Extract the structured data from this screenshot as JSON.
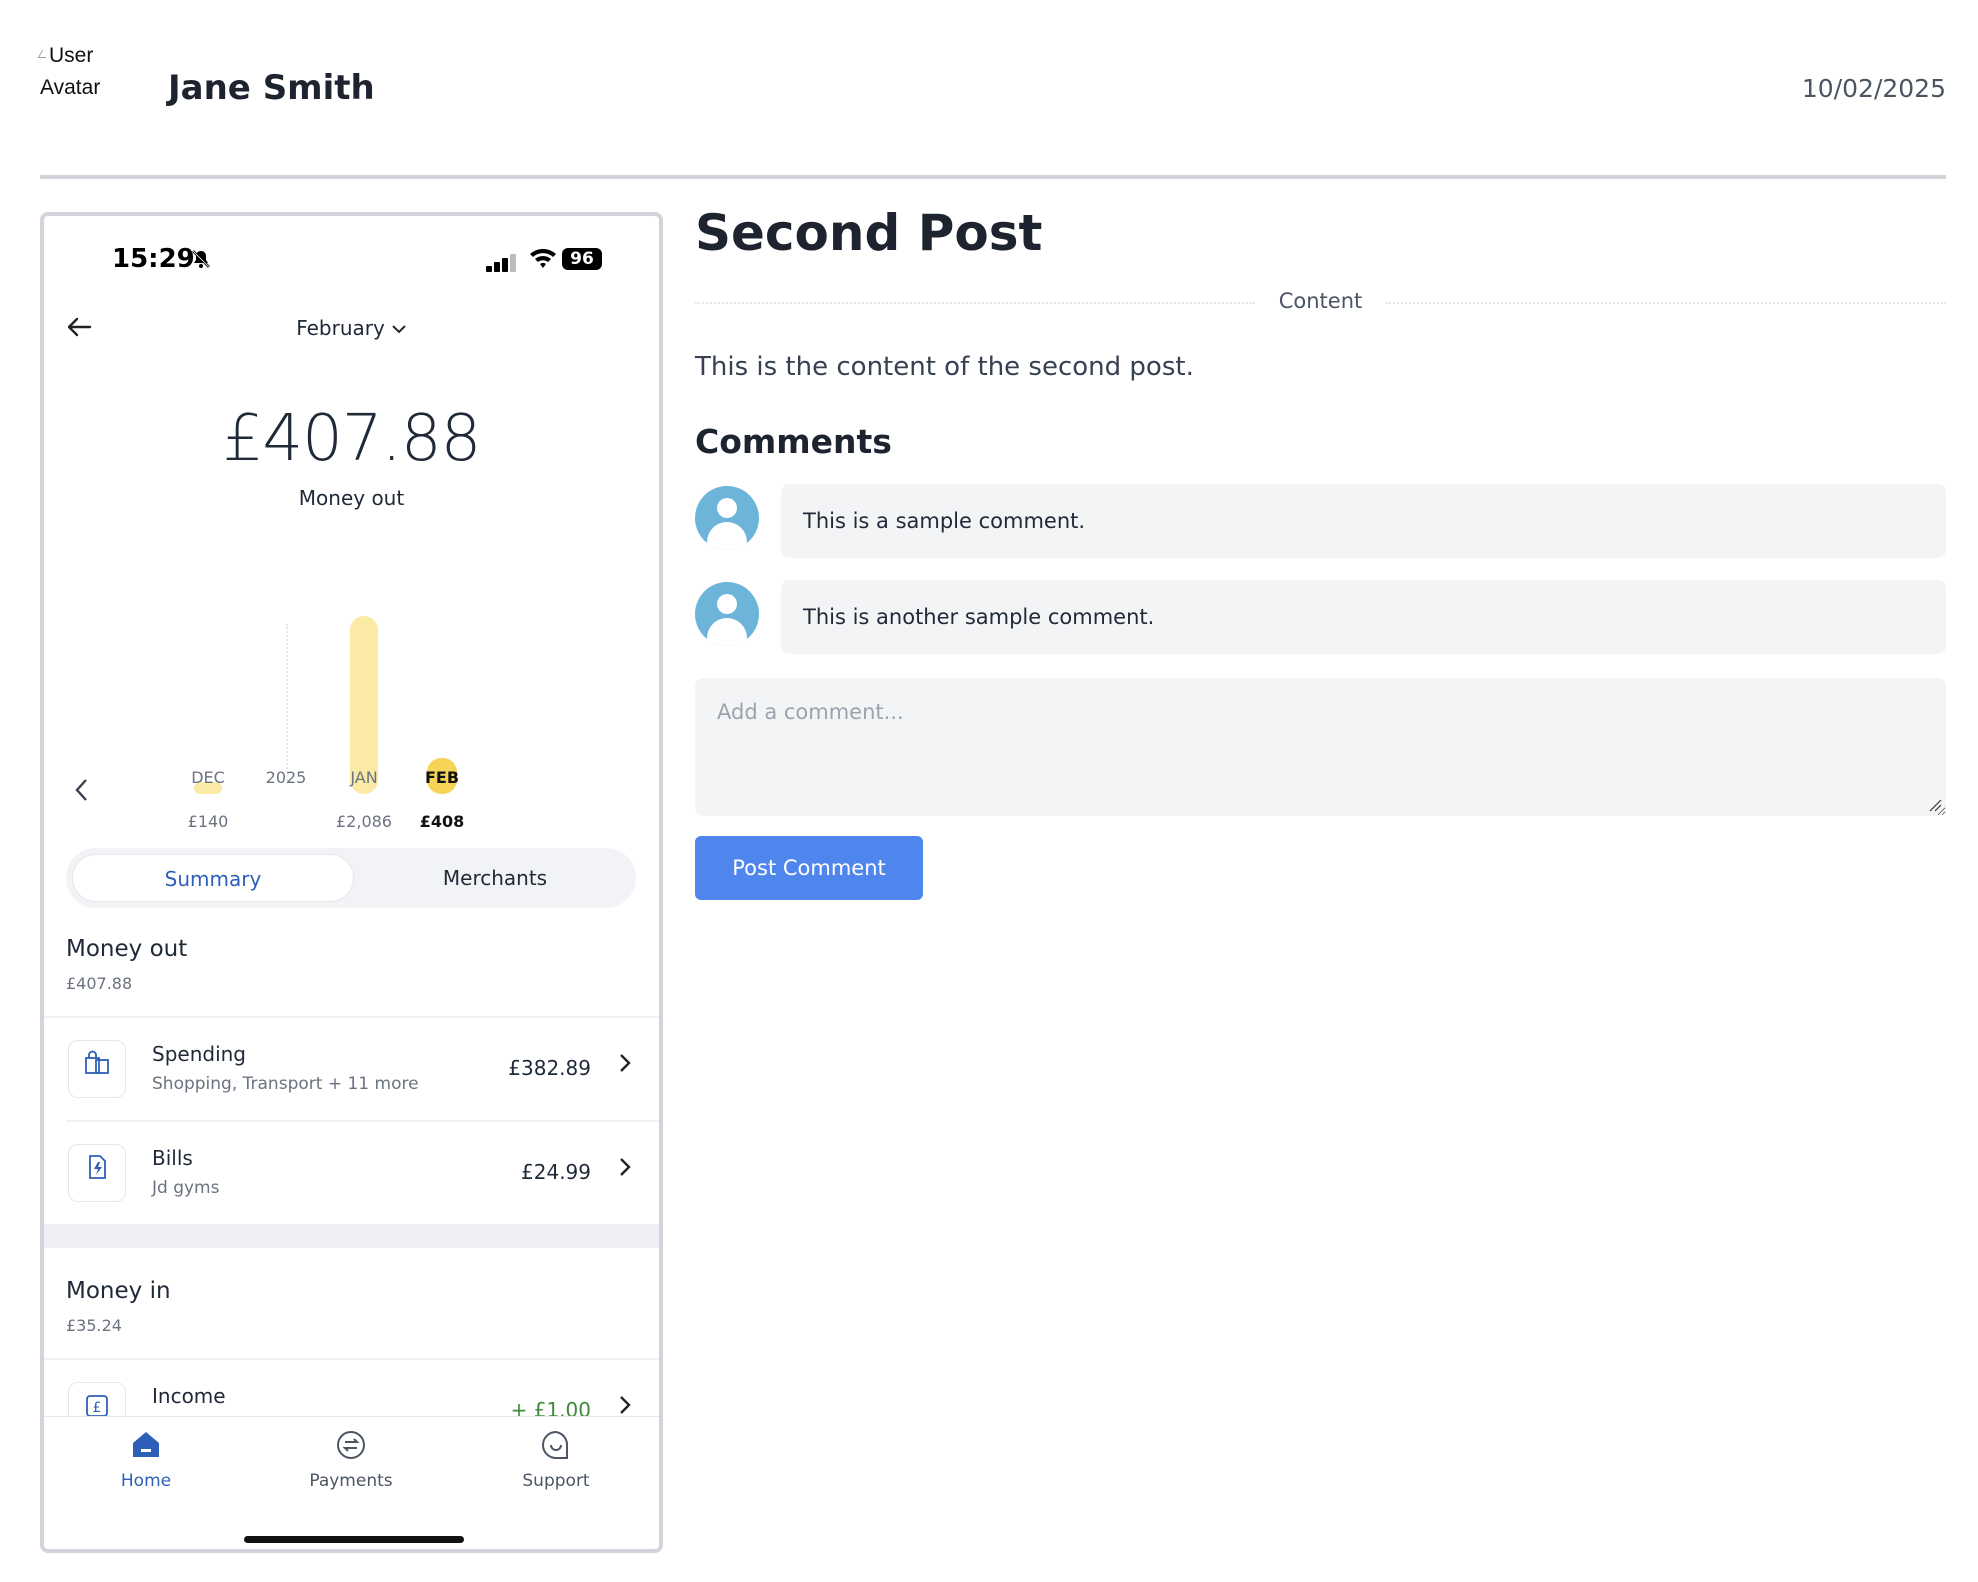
{
  "header": {
    "avatar_alt": "User Avatar",
    "author": "Jane Smith",
    "date": "10/02/2025"
  },
  "phone": {
    "status_bar": {
      "time": "15:29",
      "battery": "96"
    },
    "nav": {
      "month": "February"
    },
    "summary": {
      "amount": "£407.88",
      "label": "Money out"
    },
    "chart_data": {
      "type": "bar",
      "categories": [
        "DEC",
        "2025",
        "JAN",
        "FEB"
      ],
      "values": [
        140,
        null,
        2086,
        408
      ],
      "value_labels": [
        "£140",
        "",
        "£2,086",
        "£408"
      ],
      "active_index": 3,
      "colors": {
        "bar": "#faeaa5",
        "active": "#f5d457"
      }
    },
    "tabs": {
      "summary": "Summary",
      "merchants": "Merchants"
    },
    "money_out": {
      "title": "Money out",
      "amount": "£407.88",
      "rows": [
        {
          "icon": "shopping-bags-icon",
          "title": "Spending",
          "subtitle": "Shopping, Transport + 11 more",
          "value": "£382.89"
        },
        {
          "icon": "bill-lightning-icon",
          "title": "Bills",
          "subtitle": "Jd gyms",
          "value": "£24.99"
        }
      ]
    },
    "money_in": {
      "title": "Money in",
      "amount": "£35.24",
      "rows": [
        {
          "icon": "pound-icon",
          "title": "Income",
          "value": "+ £1.00"
        }
      ]
    },
    "tabbar": {
      "home": "Home",
      "payments": "Payments",
      "support": "Support"
    },
    "accent": "#2d5fb8"
  },
  "post": {
    "title": "Second Post",
    "divider_label": "Content",
    "body": "This is the content of the second post.",
    "comments_heading": "Comments",
    "comments": [
      {
        "text": "This is a sample comment."
      },
      {
        "text": "This is another sample comment."
      }
    ],
    "comment_placeholder": "Add a comment...",
    "submit_label": "Post Comment",
    "button_color": "#4f86ee"
  }
}
